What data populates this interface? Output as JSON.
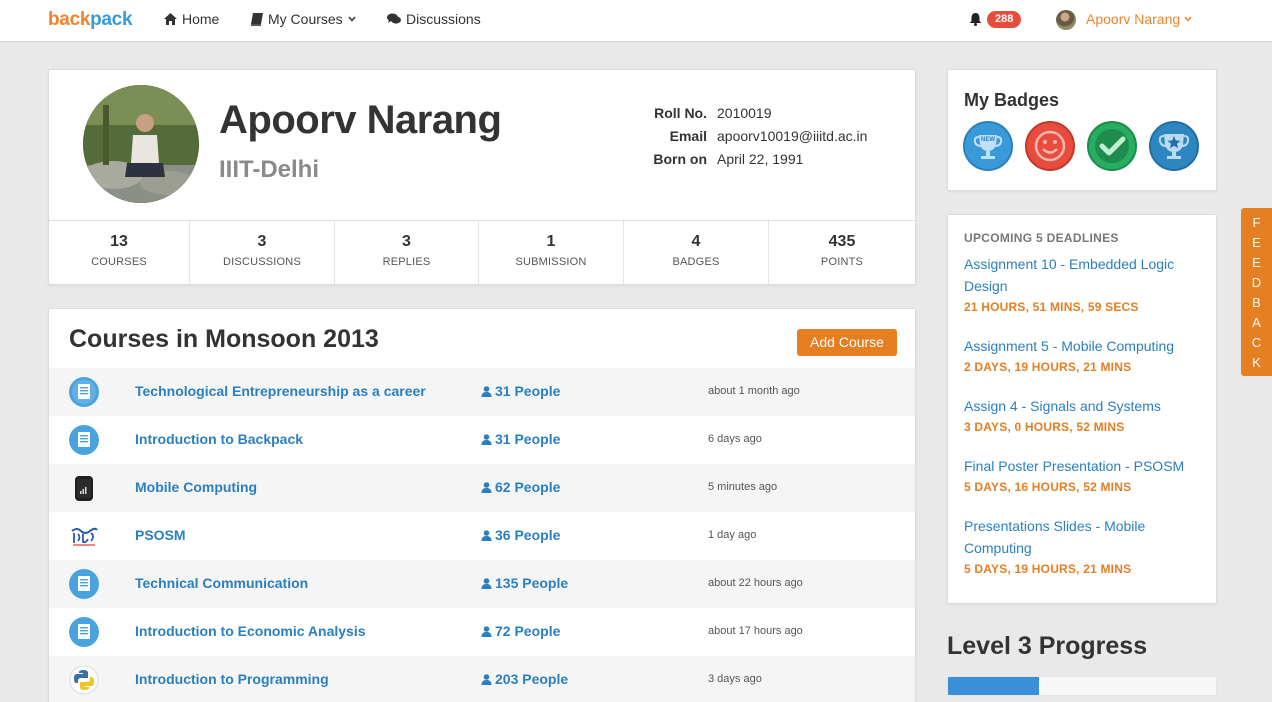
{
  "nav": {
    "brand_part1": "back",
    "brand_part2": "pack",
    "home": "Home",
    "my_courses": "My Courses",
    "discussions": "Discussions",
    "notification_count": "288",
    "user_name": "Apoorv Narang"
  },
  "profile": {
    "name": "Apoorv Narang",
    "institute": "IIIT-Delhi",
    "roll_label": "Roll No.",
    "roll_value": "2010019",
    "email_label": "Email",
    "email_value": "apoorv10019@iiitd.ac.in",
    "born_label": "Born on",
    "born_value": "April 22, 1991",
    "stats": [
      {
        "value": "13",
        "label": "COURSES"
      },
      {
        "value": "3",
        "label": "DISCUSSIONS"
      },
      {
        "value": "3",
        "label": "REPLIES"
      },
      {
        "value": "1",
        "label": "SUBMISSION"
      },
      {
        "value": "4",
        "label": "BADGES"
      },
      {
        "value": "435",
        "label": "POINTS"
      }
    ]
  },
  "courses": {
    "title": "Courses in Monsoon 2013",
    "add_label": "Add Course",
    "items": [
      {
        "name": "Technological Entrepreneurship as a career",
        "people": "31 People",
        "time": "about 1 month ago",
        "icon": "book-icon"
      },
      {
        "name": "Introduction to Backpack",
        "people": "31 People",
        "time": "6 days ago",
        "icon": "book-icon"
      },
      {
        "name": "Mobile Computing",
        "people": "62 People",
        "time": "5 minutes ago",
        "icon": "phone-icon"
      },
      {
        "name": "PSOSM",
        "people": "36 People",
        "time": "1 day ago",
        "icon": "precog-logo-icon"
      },
      {
        "name": "Technical Communication",
        "people": "135 People",
        "time": "about 22 hours ago",
        "icon": "book-icon"
      },
      {
        "name": "Introduction to Economic Analysis",
        "people": "72 People",
        "time": "about 17 hours ago",
        "icon": "book-icon"
      },
      {
        "name": "Introduction to Programming",
        "people": "203 People",
        "time": "3 days ago",
        "icon": "python-logo-icon"
      }
    ]
  },
  "badges": {
    "title": "My Badges",
    "items": [
      {
        "icon": "new-trophy-icon",
        "color": "#3a9ad9"
      },
      {
        "icon": "smiley-icon",
        "color": "#e74c3c"
      },
      {
        "icon": "checkmark-icon",
        "color": "#27ae60"
      },
      {
        "icon": "star-trophy-icon",
        "color": "#2e86c1"
      }
    ]
  },
  "deadlines": {
    "heading": "UPCOMING 5 DEADLINES",
    "items": [
      {
        "title": "Assignment 10 - Embedded Logic Design",
        "remaining": "21 HOURS, 51 MINS, 59 SECS"
      },
      {
        "title": "Assignment 5 - Mobile Computing",
        "remaining": "2 DAYS, 19 HOURS, 21 MINS"
      },
      {
        "title": "Assign 4 - Signals and Systems",
        "remaining": "3 DAYS, 0 HOURS, 52 MINS"
      },
      {
        "title": "Final Poster Presentation - PSOSM",
        "remaining": "5 DAYS, 16 HOURS, 52 MINS"
      },
      {
        "title": "Presentations Slides - Mobile Computing",
        "remaining": "5 DAYS, 19 HOURS, 21 MINS"
      }
    ]
  },
  "level": {
    "title": "Level 3 Progress",
    "progress_percent": 34
  },
  "feedback": {
    "label": "FEEDBACK"
  },
  "colors": {
    "accent": "#e67e22",
    "link": "#2a7fc1",
    "alert": "#e74c3c"
  }
}
